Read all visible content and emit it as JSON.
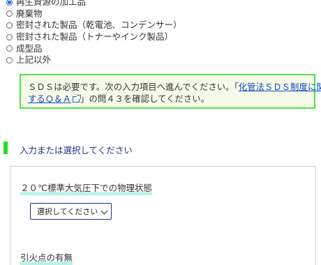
{
  "radio_group": {
    "options": [
      {
        "label": "再生資源の加工品",
        "checked": true
      },
      {
        "label": "廃棄物",
        "checked": false
      },
      {
        "label": "密封された製品（乾電池、コンデンサー）",
        "checked": false
      },
      {
        "label": "密封された製品（トナーやインク製品）",
        "checked": false
      },
      {
        "label": "成型品",
        "checked": false
      },
      {
        "label": "上記以外",
        "checked": false
      }
    ]
  },
  "notice": {
    "text_before": "ＳＤＳは必要です。次の入力項目へ進んでください。「",
    "link_line1": "化管法ＳＤＳ制度に関",
    "link_line2": "するＱ＆Ａ",
    "text_after": "」の問４３を確認してください。"
  },
  "section": {
    "title": "入力または選択してください"
  },
  "form": {
    "physical_state_label": "２０℃標準大気圧下での物理状態",
    "physical_state_select": "選択してください",
    "flash_point_label": "引火点の有無"
  },
  "colors": {
    "accent_green": "#22e022",
    "link_blue": "#1447c7",
    "radio_blue": "#1a66d6"
  },
  "icons": {
    "external_link": "external-link-icon",
    "dropdown": "chevron-down-icon"
  }
}
